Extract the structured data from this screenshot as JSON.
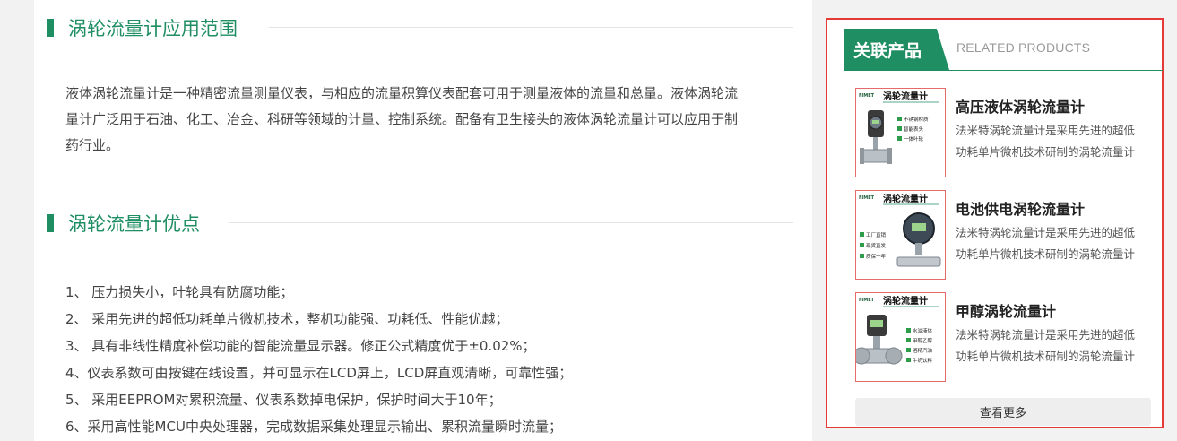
{
  "main": {
    "section1": {
      "title": "涡轮流量计应用范围",
      "paragraph_line1": "液体涡轮流量计是一种精密流量测量仪表，与相应的流量积算仪表配套可用于测量液体的流量和总量。液体涡轮流",
      "paragraph_line2": "量计广泛用于石油、化工、冶金、科研等领域的计量、控制系统。配备有卫生接头的液体涡轮流量计可以应用于制",
      "paragraph_line3": "药行业。"
    },
    "section2": {
      "title": "涡轮流量计优点",
      "items": [
        "1、 压力损失小，叶轮具有防腐功能；",
        "2、 采用先进的超低功耗单片微机技术，整机功能强、功耗低、性能优越；",
        "3、 具有非线性精度补偿功能的智能流量显示器。修正公式精度优于±0.02%；",
        "4、仪表系数可由按键在线设置，并可显示在LCD屏上，LCD屏直观清晰，可靠性强；",
        "5、 采用EEPROM对累积流量、仪表系数掉电保护，保护时间大于10年；",
        "6、采用高性能MCU中央处理器，完成数据采集处理显示输出、累积流量瞬时流量；"
      ]
    }
  },
  "sidebar": {
    "title": "关联产品",
    "subtitle": "RELATED PRODUCTS",
    "products": [
      {
        "name": "高压液体涡轮流量计",
        "desc": "法米特涡轮流量计是采用先进的超低功耗单片微机技术研制的涡轮流量计",
        "thumb_title": "涡轮流量计",
        "thumb_brand": "FIMET",
        "thumb_features": [
          "不锈钢材质",
          "智能表头",
          "一体叶轮"
        ]
      },
      {
        "name": "电池供电涡轮流量计",
        "desc": "法米特涡轮流量计是采用先进的超低功耗单片微机技术研制的涡轮流量计",
        "thumb_title": "涡轮流量计",
        "thumb_brand": "FIMET",
        "thumb_features": [
          "工厂直销",
          "现货直发",
          "质保一年"
        ]
      },
      {
        "name": "甲醇涡轮流量计",
        "desc": "法米特涡轮流量计是采用先进的超低功耗单片微机技术研制的涡轮流量计",
        "thumb_title": "涡轮流量计",
        "thumb_brand": "FIMET",
        "thumb_features": [
          "水油液体",
          "甲醇乙醇",
          "酒精汽油",
          "牛奶饮料"
        ]
      }
    ],
    "more_label": "查看更多"
  },
  "colors": {
    "accent_green": "#1f8e62",
    "highlight_red": "#e53935"
  }
}
